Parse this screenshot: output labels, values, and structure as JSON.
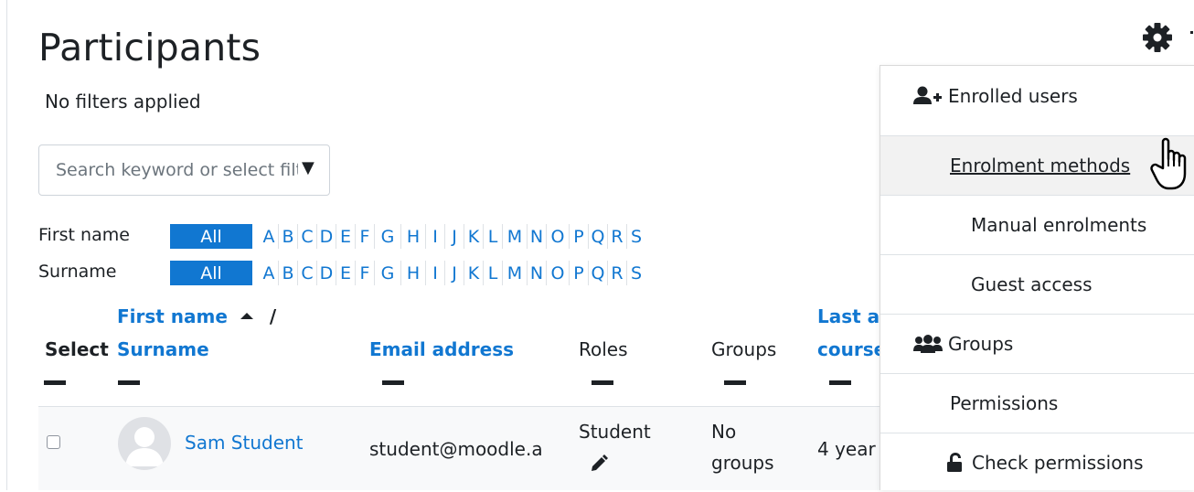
{
  "page": {
    "title": "Participants",
    "filter_status": "No filters applied"
  },
  "search": {
    "placeholder": "Search keyword or select filter"
  },
  "initials_bar": {
    "first_name_label": "First name",
    "surname_label": "Surname",
    "all_label": "All",
    "letters": [
      "A",
      "B",
      "C",
      "D",
      "E",
      "F",
      "G",
      "H",
      "I",
      "J",
      "K",
      "L",
      "M",
      "N",
      "O",
      "P",
      "Q",
      "R",
      "S"
    ]
  },
  "table": {
    "headers": {
      "select": "Select",
      "first_name": "First name",
      "separator": "/",
      "surname": "Surname",
      "email": "Email address",
      "roles": "Roles",
      "groups": "Groups",
      "last_access_line1": "Last access to",
      "last_access_line2": "course"
    },
    "rows": [
      {
        "name": "Sam Student",
        "email": "student@moodle.a",
        "role": "Student",
        "groups_line1": "No",
        "groups_line2": "groups",
        "last_access": "4 year"
      }
    ]
  },
  "settings_menu": {
    "icon": "gear-icon",
    "items": [
      {
        "label": "Enrolled users",
        "icon": "user-plus-icon"
      },
      {
        "label": "Enrolment methods",
        "state": "hovered"
      },
      {
        "label": "Manual enrolments"
      },
      {
        "label": "Guest access"
      },
      {
        "label": "Groups",
        "icon": "users-icon"
      },
      {
        "label": "Permissions"
      },
      {
        "label": "Check permissions",
        "icon": "unlock-icon"
      }
    ]
  },
  "colors": {
    "link": "#1177d1",
    "active_initial": "#1177d1",
    "menu_hover": "#f2f2f2"
  }
}
